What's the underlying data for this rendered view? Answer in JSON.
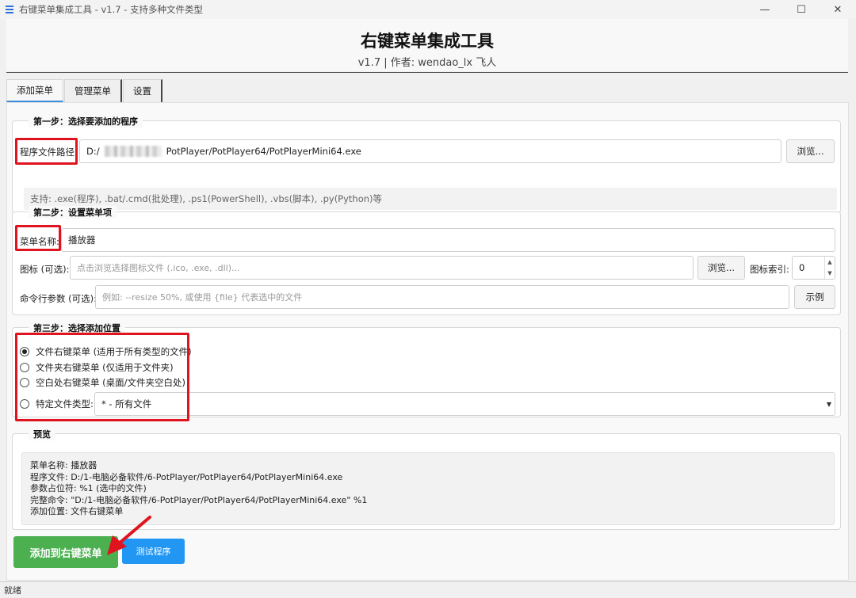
{
  "window": {
    "title": "右键菜单集成工具 - v1.7 - 支持多种文件类型",
    "app_icon": "menu-icon",
    "controls": [
      "minimize-icon",
      "maximize-icon",
      "close-icon"
    ]
  },
  "header": {
    "title": "右键菜单集成工具",
    "subtitle": "v1.7 | 作者: wendao_lx 飞人"
  },
  "tabs": [
    {
      "label": "添加菜单",
      "active": true
    },
    {
      "label": "管理菜单",
      "active": false
    },
    {
      "label": "设置",
      "active": false
    }
  ],
  "step1": {
    "legend": "第一步：选择要添加的程序",
    "path_label": "程序文件路径:",
    "path_prefix": "D:/",
    "path_suffix": "PotPlayer/PotPlayer64/PotPlayerMini64.exe",
    "browse": "浏览...",
    "support": "支持: .exe(程序), .bat/.cmd(批处理), .ps1(PowerShell), .vbs(脚本), .py(Python)等"
  },
  "step2": {
    "legend": "第二步：设置菜单项",
    "name_label": "菜单名称:",
    "name_value": "播放器",
    "icon_label": "图标 (可选):",
    "icon_placeholder": "点击浏览选择图标文件 (.ico, .exe, .dll)...",
    "icon_browse": "浏览...",
    "index_label": "图标索引:",
    "index_value": "0",
    "args_label": "命令行参数 (可选):",
    "args_placeholder": "例如: --resize 50%, 或使用 {file} 代表选中的文件",
    "example_button": "示例"
  },
  "step3": {
    "legend": "第三步：选择添加位置",
    "options": [
      {
        "label": "文件右键菜单 (适用于所有类型的文件)",
        "checked": true
      },
      {
        "label": "文件夹右键菜单 (仅适用于文件夹)",
        "checked": false
      },
      {
        "label": "空白处右键菜单 (桌面/文件夹空白处)",
        "checked": false
      },
      {
        "label": "特定文件类型:",
        "checked": false
      }
    ],
    "filetype_value": "* - 所有文件"
  },
  "preview": {
    "legend": "预览",
    "lines": [
      "菜单名称: 播放器",
      "程序文件: D:/1-电脑必备软件/6-PotPlayer/PotPlayer64/PotPlayerMini64.exe",
      "参数占位符: %1 (选中的文件)",
      "完整命令: \"D:/1-电脑必备软件/6-PotPlayer/PotPlayer64/PotPlayerMini64.exe\" %1",
      "添加位置: 文件右键菜单"
    ]
  },
  "actions": {
    "add": "添加到右键菜单",
    "test": "测试程序"
  },
  "status": "就绪",
  "colors": {
    "annotation_red": "#e0141e",
    "primary_green": "#4caf50",
    "secondary_blue": "#2196f3",
    "tab_accent": "#3c8ee0"
  }
}
